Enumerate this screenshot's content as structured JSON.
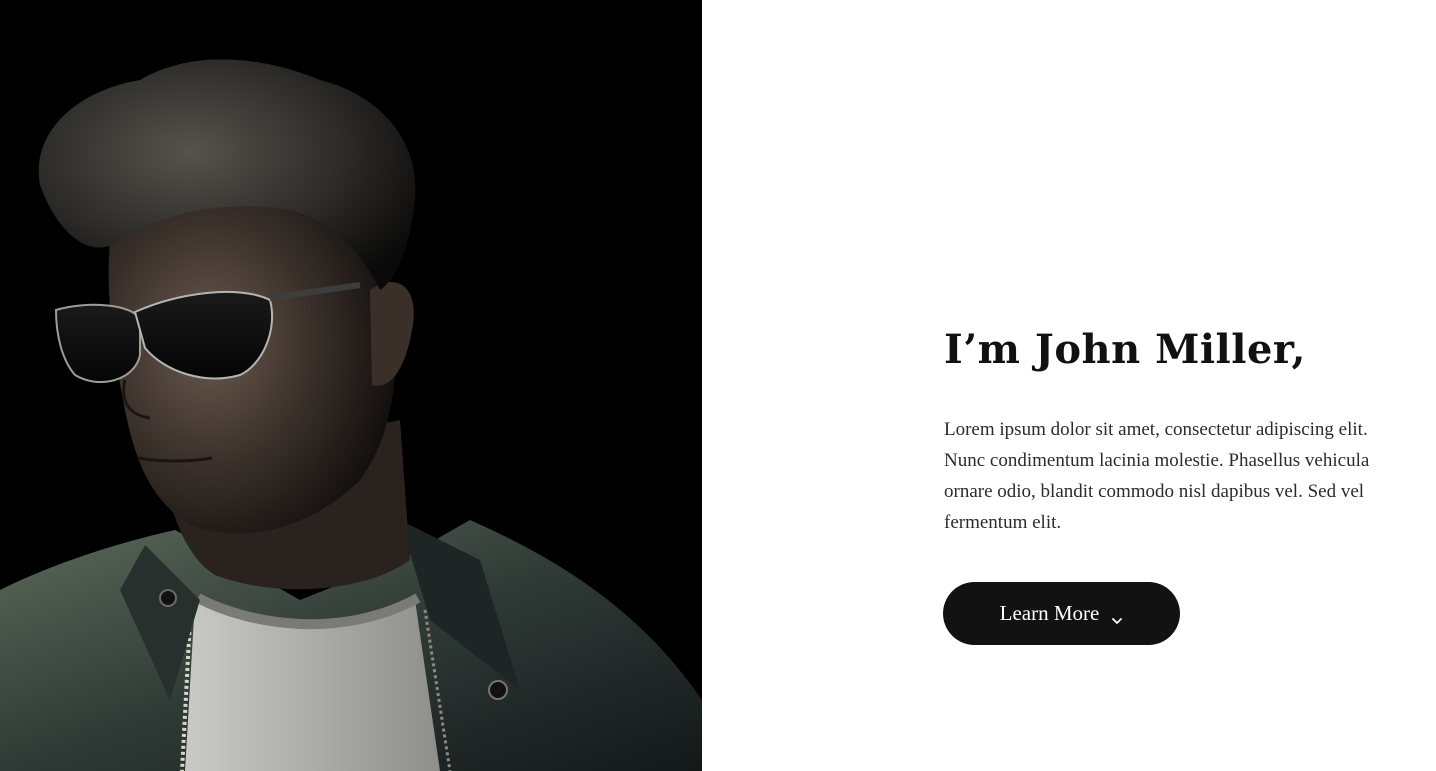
{
  "hero": {
    "image_alt": "Portrait of a man wearing sunglasses and a denim jacket",
    "headline": "I’m John Miller,",
    "bio": "Lorem ipsum dolor sit amet, consectetur adipiscing elit. Nunc condimentum lacinia molestie. Phasellus vehicula ornare odio, blandit commodo nisl dapibus vel. Sed vel fermentum elit.",
    "cta_label": "Learn More",
    "cta_icon": "chevron-down-icon"
  },
  "colors": {
    "photo_background": "#000000",
    "page_background": "#ffffff",
    "button_background": "#121212",
    "button_text": "#ffffff",
    "headline_text": "#111111"
  }
}
